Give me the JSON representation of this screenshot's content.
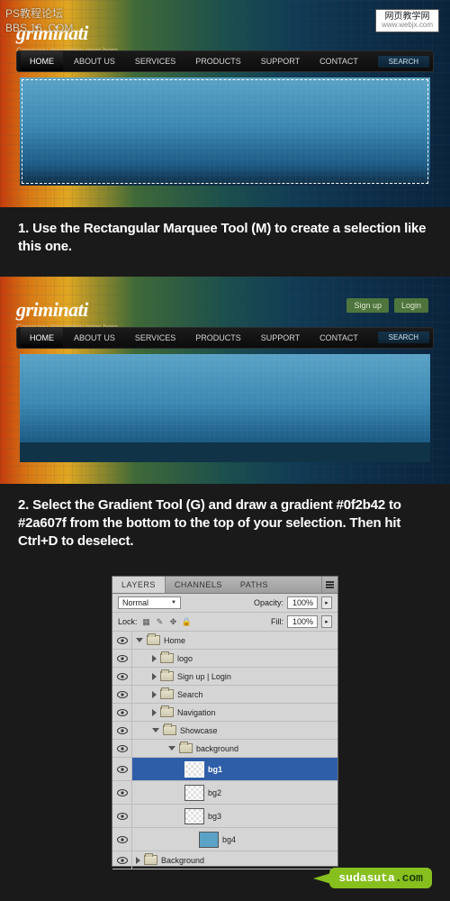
{
  "watermarks": {
    "left_line1": "PS教程论坛",
    "left_line2": "BBS.16 .COM",
    "right_title": "网页教学网",
    "right_sub": "www.webjx.com"
  },
  "mock": {
    "brand": "griminati",
    "tagline": "Company description goes here",
    "auth": {
      "signup": "Sign up",
      "login": "Login"
    },
    "nav": {
      "home": "HOME",
      "about": "ABOUT US",
      "services": "SERVICES",
      "products": "PRODUCTS",
      "support": "SUPPORT",
      "contact": "CONTACT",
      "search": "SEARCH"
    }
  },
  "steps": {
    "s1": "1. Use the Rectangular Marquee Tool (M) to create a selection like this one.",
    "s2": "2. Select the Gradient Tool (G) and draw a gradient #0f2b42 to #2a607f from the bottom to the top of your selection. Then hit Ctrl+D to deselect."
  },
  "layers_panel": {
    "tabs": {
      "layers": "LAYERS",
      "channels": "CHANNELS",
      "paths": "PATHS"
    },
    "blend_mode": "Normal",
    "opacity_label": "Opacity:",
    "opacity_value": "100%",
    "lock_label": "Lock:",
    "fill_label": "Fill:",
    "fill_value": "100%",
    "tree": {
      "home": "Home",
      "logo": "logo",
      "sign": "Sign up  |  Login",
      "search": "Search",
      "navigation": "Navigation",
      "showcase": "Showcase",
      "background_group": "background",
      "bg1": "bg1",
      "bg2": "bg2",
      "bg3": "bg3",
      "bg4": "bg4",
      "background": "Background"
    }
  },
  "footer": {
    "brand": "sudasuta",
    "suffix": ".com"
  }
}
